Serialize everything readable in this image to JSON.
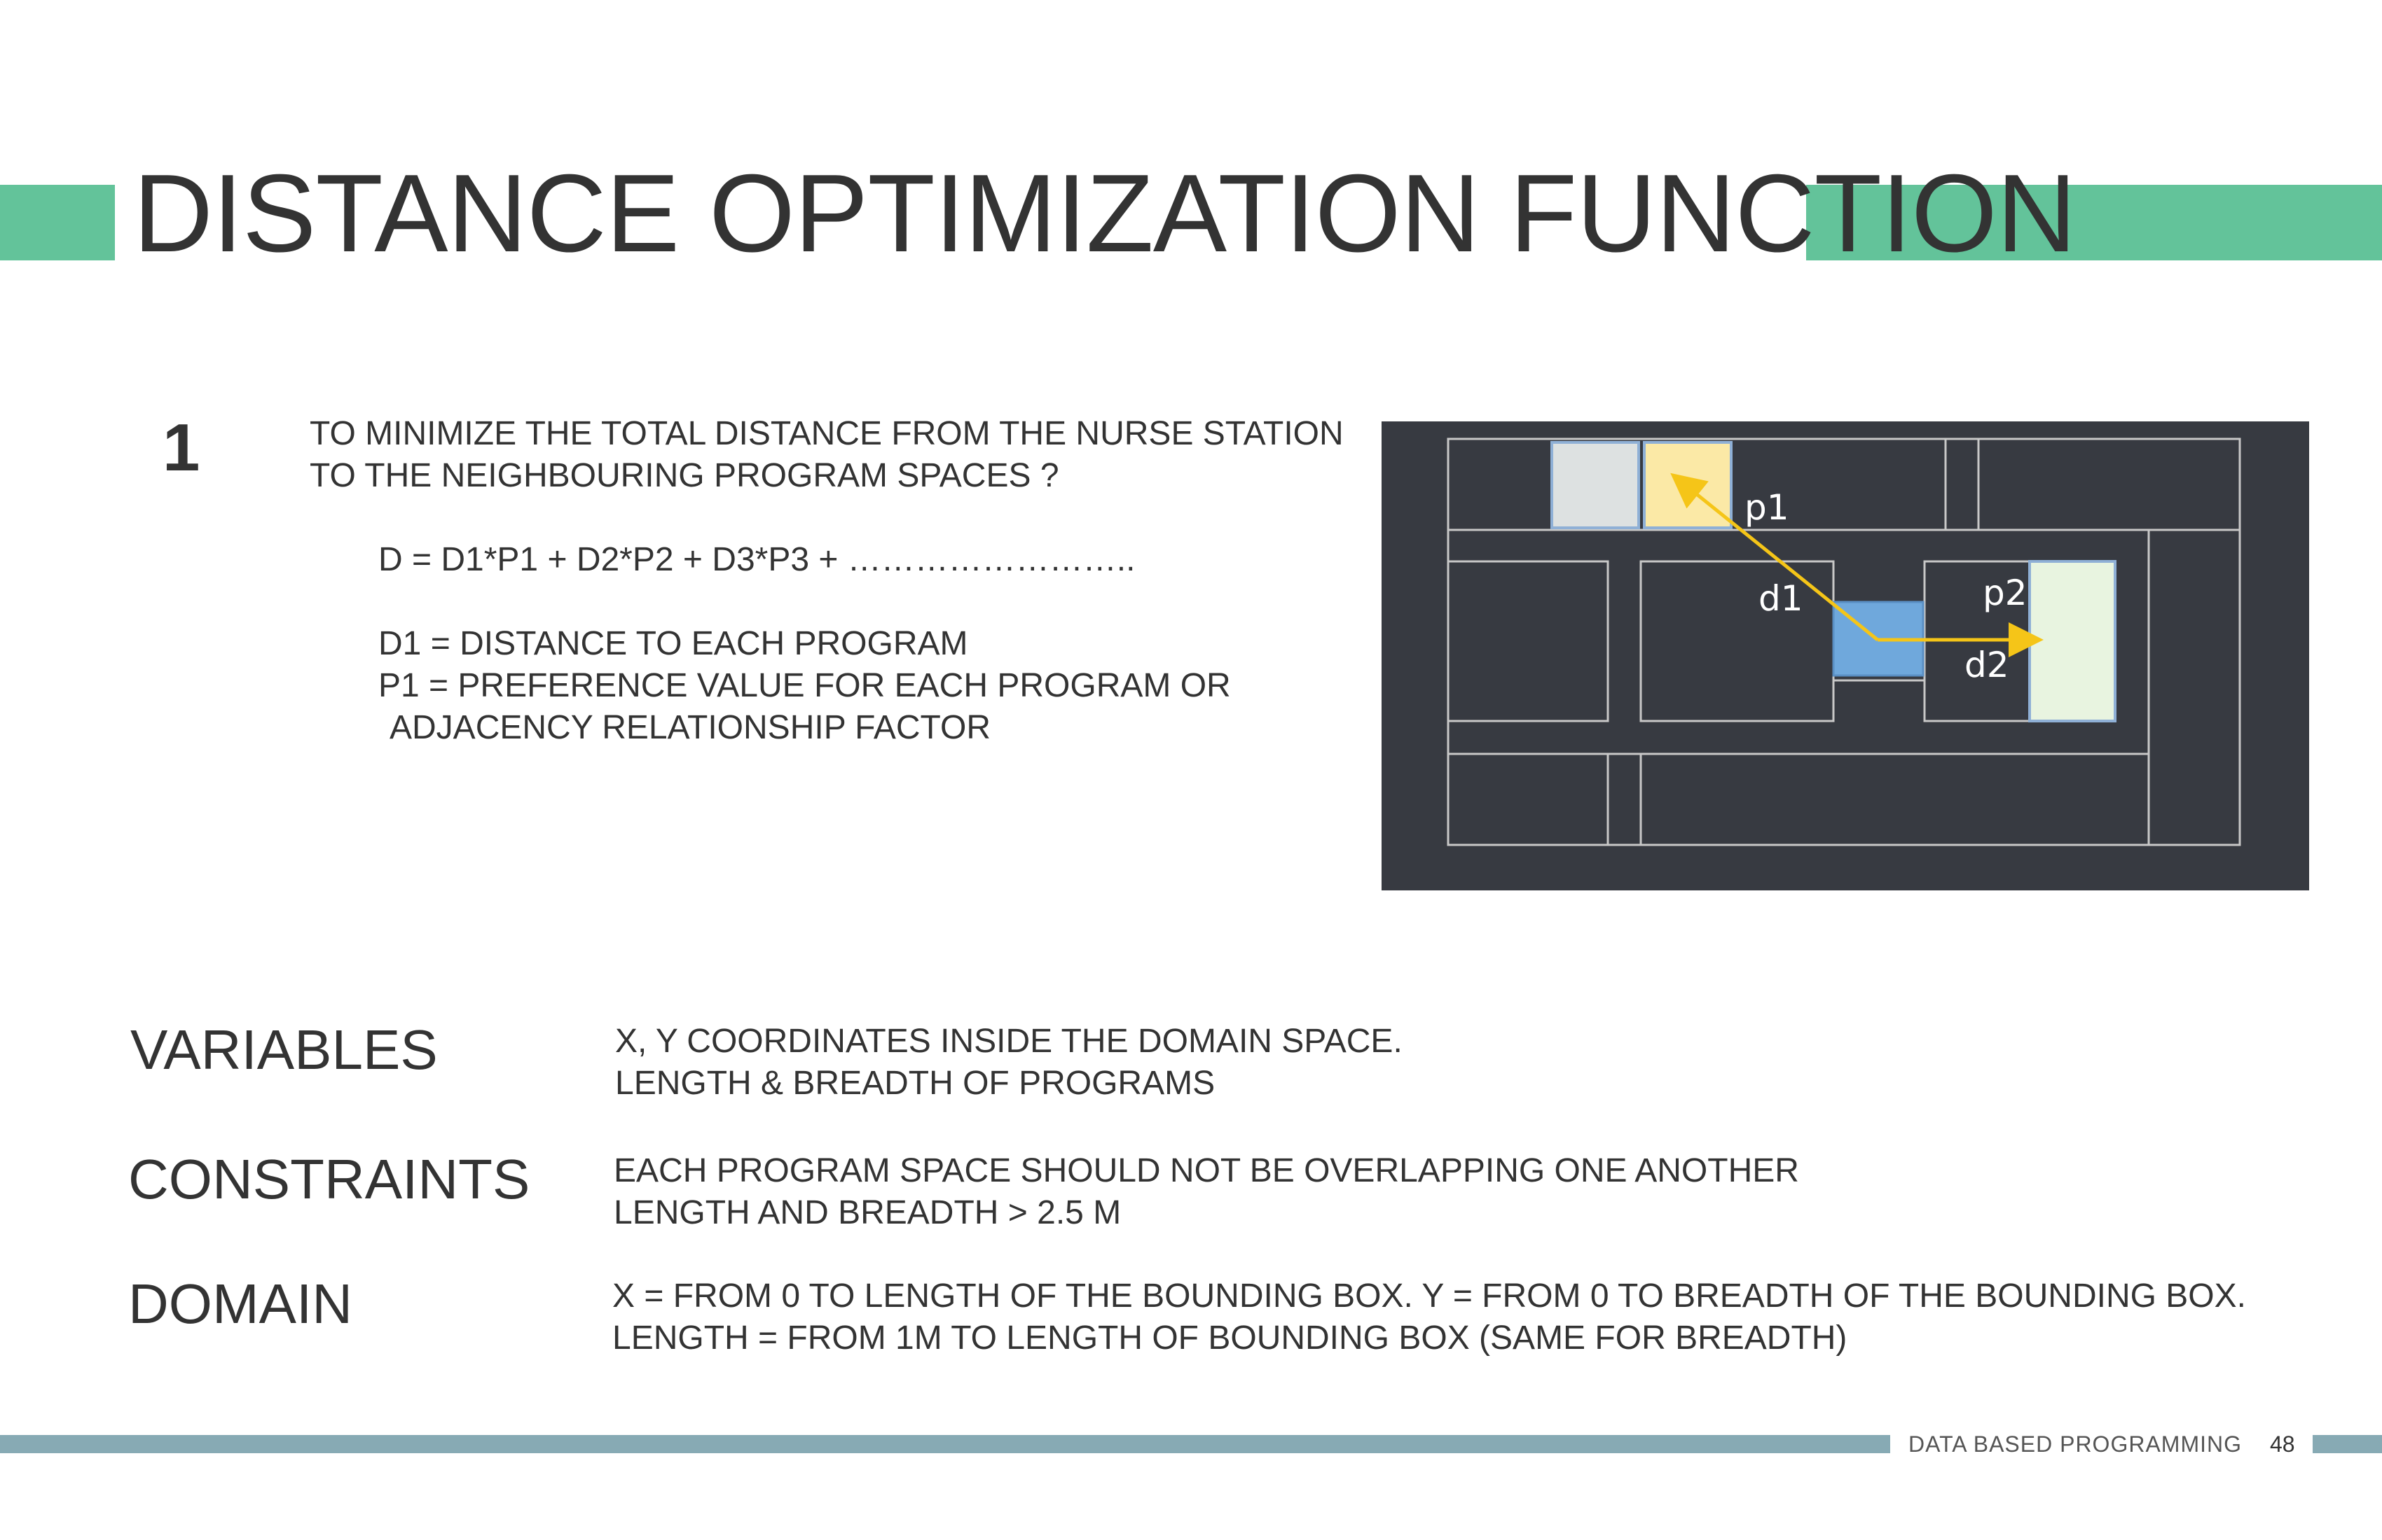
{
  "title": "DISTANCE OPTIMIZATION FUNCTION",
  "objective": {
    "number": "1",
    "question_line1": "TO MINIMIZE THE TOTAL DISTANCE FROM THE NURSE STATION",
    "question_line2": "TO THE NEIGHBOURING PROGRAM SPACES ?",
    "formula": "D = D1*P1 + D2*P2 + D3*P3 + ……………………..",
    "def_d1": "D1 = DISTANCE TO EACH PROGRAM",
    "def_p1_line1": "P1 = PREFERENCE VALUE FOR EACH PROGRAM OR",
    "def_p1_line2": "ADJACENCY RELATIONSHIP FACTOR"
  },
  "diagram": {
    "labels": {
      "p1": "p1",
      "p2": "p2",
      "d1": "d1",
      "d2": "d2"
    },
    "colors": {
      "background": "#373a41",
      "outline": "#c8c8c8",
      "nurse_station": "#6fa8dc",
      "program_p1": "#fbe9a6",
      "program_p2": "#e8f4e0",
      "program_grey": "#dde1e1",
      "arrow": "#f5c518"
    }
  },
  "sections": [
    {
      "label": "VARIABLES",
      "line1": "X, Y COORDINATES INSIDE THE DOMAIN SPACE.",
      "line2": "LENGTH & BREADTH OF PROGRAMS"
    },
    {
      "label": "CONSTRAINTS",
      "line1": "EACH PROGRAM SPACE SHOULD NOT BE OVERLAPPING ONE ANOTHER",
      "line2": "LENGTH AND BREADTH > 2.5 M"
    },
    {
      "label": "DOMAIN",
      "line1": "X = FROM 0 TO LENGTH OF THE BOUNDING BOX. Y = FROM 0 TO BREADTH OF THE BOUNDING BOX.",
      "line2": "LENGTH = FROM 1M TO LENGTH OF BOUNDING BOX (SAME FOR BREADTH)"
    }
  ],
  "footer": {
    "title": "DATA BASED PROGRAMMING",
    "page": "48"
  },
  "colors": {
    "accent_green": "#63c39a",
    "footer_bar": "#87aab4"
  }
}
